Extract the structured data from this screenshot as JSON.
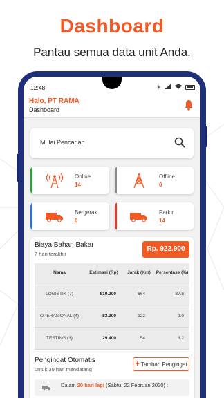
{
  "hero": {
    "title": "Dashboard",
    "subtitle": "Pantau semua data unit Anda."
  },
  "statusbar": {
    "time": "12:48"
  },
  "appbar": {
    "greeting": "Halo, PT RAMA",
    "title": "Dashboard",
    "notification_icon": "bell-icon"
  },
  "search": {
    "placeholder": "Mulai Pencarian",
    "icon": "search-icon"
  },
  "units": [
    {
      "label": "Online",
      "value": "14",
      "accent": "#2e9e3f",
      "icon": "radio-tower-icon"
    },
    {
      "label": "Offline",
      "value": "0",
      "accent": "#8a8a8a",
      "icon": "tower-offline-icon"
    },
    {
      "label": "Bergerak",
      "value": "0",
      "accent": "#2e6fd6",
      "icon": "truck-moving-icon"
    },
    {
      "label": "Parkir",
      "value": "14",
      "accent": "#e33b2b",
      "icon": "truck-parked-icon"
    }
  ],
  "fuel": {
    "title": "Biaya Bahan Bakar",
    "subtitle": "7 hari terakhir",
    "total": "Rp. 922.900",
    "columns": [
      "Nama",
      "Estimasi (Rp)",
      "Jarak (Km)",
      "Persentase (%)"
    ],
    "rows": [
      {
        "name": "LOGISTIK (7)",
        "estimate": "810.200",
        "distance": "664",
        "percent": "87.8"
      },
      {
        "name": "OPERASIONAL (4)",
        "estimate": "83.300",
        "distance": "122",
        "percent": "9.0"
      },
      {
        "name": "TESTING (3)",
        "estimate": "29.400",
        "distance": "54",
        "percent": "3.2"
      }
    ]
  },
  "reminder": {
    "title": "Pengingat Otomatis",
    "subtitle": "untuk 30 hari mendatang",
    "add_button": "Tambah Pengingat",
    "item_prefix": "Dalam ",
    "item_highlight": "20 hari lagi",
    "item_suffix": " (Sabtu, 22 Februari 2020) :"
  },
  "colors": {
    "accent": "#f15a24",
    "phone_frame": "#1f2f7a"
  }
}
